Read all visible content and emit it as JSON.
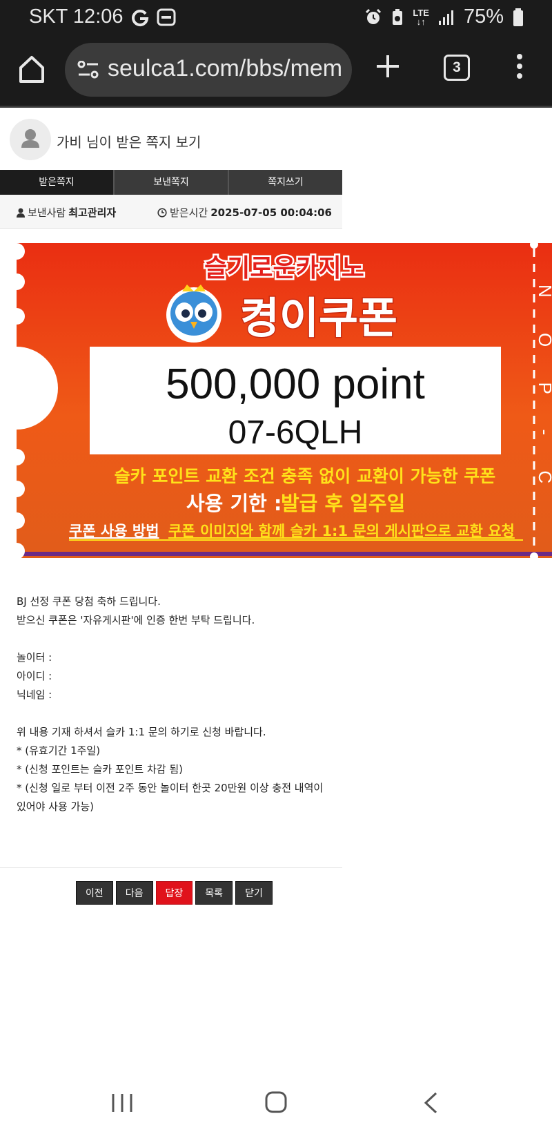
{
  "status_bar": {
    "carrier_time": "SKT 12:06",
    "network_top": "LTE",
    "battery": "75%",
    "icons": [
      "google-icon",
      "app-icon",
      "alarm-icon",
      "battery-saver-icon",
      "signal-icon",
      "battery-icon"
    ]
  },
  "browser": {
    "url": "seulca1.com/bbs/mem",
    "tab_count": "3",
    "icons": [
      "home-icon",
      "site-settings-icon",
      "plus-icon",
      "tabs-icon",
      "more-vertical-icon"
    ]
  },
  "memo": {
    "title": "가비 님이 받은 쪽지 보기",
    "tabs": [
      {
        "label": "받은쪽지",
        "active": true
      },
      {
        "label": "보낸쪽지",
        "active": false
      },
      {
        "label": "쪽지쓰기",
        "active": false
      }
    ],
    "sender_label": "보낸사람",
    "sender_name": "최고관리자",
    "time_label": "받은시간",
    "time_value": "2025-07-05 00:04:06"
  },
  "coupon": {
    "brand": "슬기로운카지노",
    "name": "켱이쿠폰",
    "amount": "500,000 point",
    "code": "07-6QLH",
    "desc": "슬카 포인트 교환 조건 충족 없이 교환이 가능한 쿠폰",
    "limit_label": "사용 기한 :",
    "limit_value": "발급 후 일주일",
    "usage_label": "쿠폰 사용 방법",
    "usage_value": "쿠폰 이미지와 함께 슬카 1:1 문의 게시판으로 교환 요청",
    "side_text": "N O P - C",
    "colors": {
      "orange": "#f0621a",
      "red": "#e41f1b",
      "yellow": "#ffe21a",
      "purple": "#6b2a86"
    }
  },
  "message_lines": [
    "BJ 선정 쿠폰 당첨 축하 드립니다.",
    "받으신 쿠폰은 '자유게시판'에 인증 한번 부탁 드립니다.",
    "",
    "놀이터 :",
    "아이디 :",
    "닉네임 :",
    "",
    "위 내용 기재 하셔서 슬카 1:1 문의 하기로 신청 바랍니다.",
    "* (유효기간 1주일)",
    "* (신청 포인트는 슬카 포인트 차감 됨)",
    "* (신청 일로 부터 이전 2주 동안 놀이터 한곳 20만원 이상 충전 내역이",
    "있어야 사용 가능)"
  ],
  "buttons": {
    "prev": "이전",
    "next": "다음",
    "reply": "답장",
    "list": "목록",
    "close": "닫기"
  },
  "nav": {
    "icons": [
      "recent-apps-icon",
      "home-nav-icon",
      "back-icon"
    ]
  }
}
